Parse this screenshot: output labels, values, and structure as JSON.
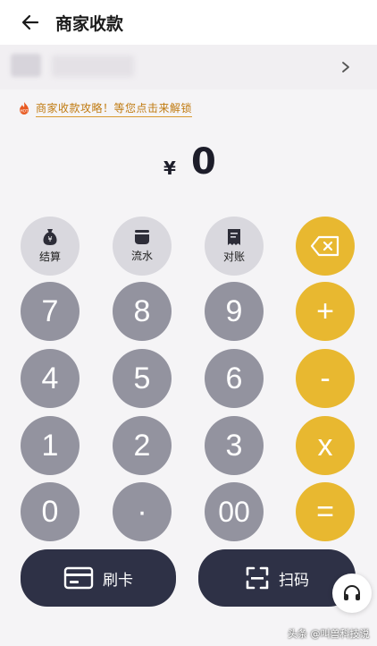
{
  "header": {
    "title": "商家收款"
  },
  "promo": {
    "badge": "HOT",
    "text": "商家收款攻略！等您点击来解锁"
  },
  "amount": {
    "currency": "¥",
    "value": "0"
  },
  "function_keys": [
    {
      "label": "结算",
      "icon": "money-bag-icon"
    },
    {
      "label": "流水",
      "icon": "pot-icon"
    },
    {
      "label": "对账",
      "icon": "receipt-icon"
    }
  ],
  "keypad": {
    "backspace_icon": "backspace-icon",
    "rows": [
      [
        "7",
        "8",
        "9",
        "+"
      ],
      [
        "4",
        "5",
        "6",
        "-"
      ],
      [
        "1",
        "2",
        "3",
        "x"
      ],
      [
        "0",
        "·",
        "00",
        "="
      ]
    ]
  },
  "bottom": {
    "card_label": "刷卡",
    "scan_label": "扫码"
  },
  "watermark": "头条 @叫兽科技说",
  "colors": {
    "number_key": "#93939f",
    "operator_key": "#e8b830",
    "function_key": "#d9d8de",
    "bottom_button": "#2e3146",
    "promo_text": "#c07a10"
  }
}
